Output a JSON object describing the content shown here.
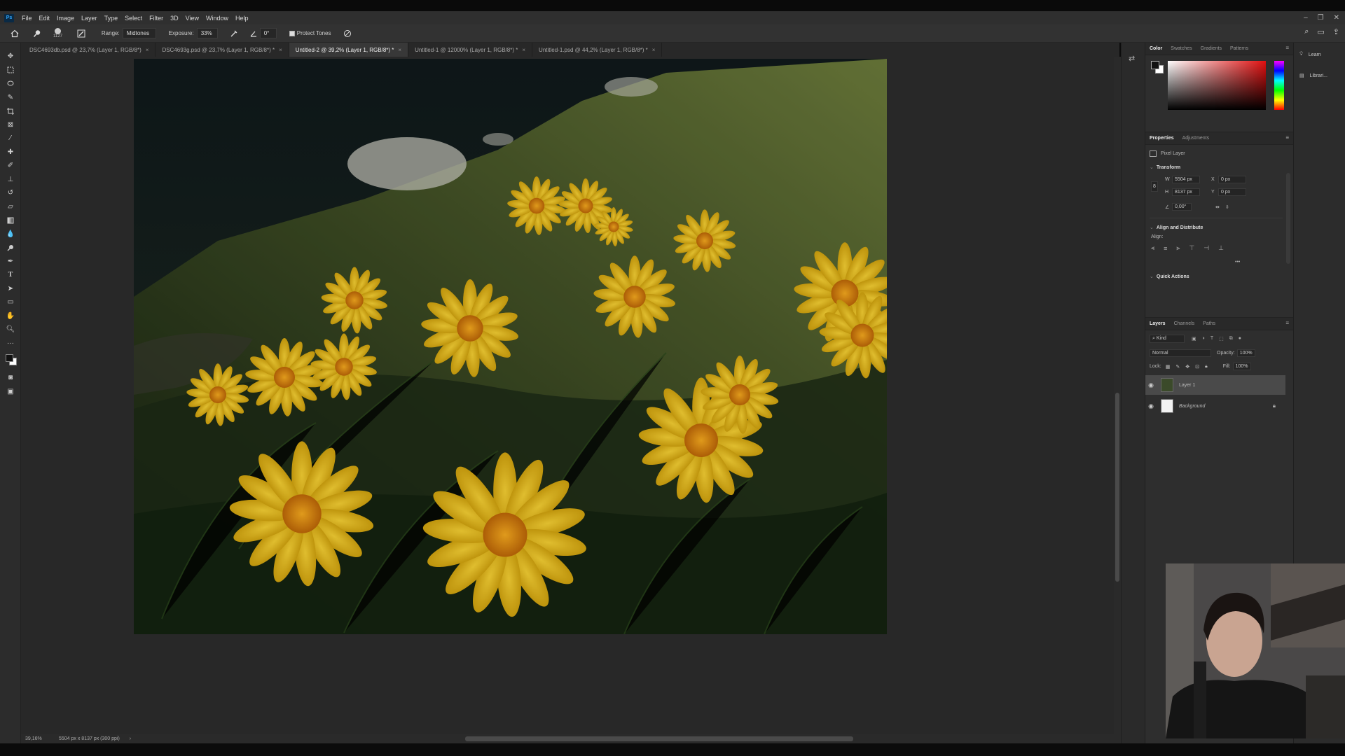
{
  "app": {
    "logo": "Ps"
  },
  "menu": [
    "File",
    "Edit",
    "Image",
    "Layer",
    "Type",
    "Select",
    "Filter",
    "3D",
    "View",
    "Window",
    "Help"
  ],
  "window_controls": {
    "minimize": "–",
    "restore": "❐",
    "close": "✕"
  },
  "options_bar": {
    "brush_size": "1127",
    "range_label": "Range:",
    "range_value": "Midtones",
    "exposure_label": "Exposure:",
    "exposure_value": "33%",
    "angle_value": "0°",
    "protect_tones": "Protect Tones"
  },
  "tabs": [
    {
      "label": "DSC4693db.psd @ 23,7% (Layer 1, RGB/8*)",
      "close": "×"
    },
    {
      "label": "DSC4693g.psd @ 23,7% (Layer 1, RGB/8*) *",
      "close": "×"
    },
    {
      "label": "Untitled-2 @ 39,2% (Layer 1, RGB/8*) *",
      "close": "×"
    },
    {
      "label": "Untitled-1 @ 12000% (Layer 1, RGB/8*) *",
      "close": "×"
    },
    {
      "label": "Untitled-1.psd @ 44,2% (Layer 1, RGB/8*) *",
      "close": "×"
    }
  ],
  "status": {
    "zoom": "39,16%",
    "doc_size": "5504 px x 8137 px (300 ppi)",
    "arrow": "›"
  },
  "color_panel": {
    "tabs": [
      "Color",
      "Swatches",
      "Gradients",
      "Patterns"
    ]
  },
  "properties_panel": {
    "tabs": [
      "Properties",
      "Adjustments"
    ],
    "layer_type": "Pixel Layer",
    "transform_title": "Transform",
    "w_label": "W",
    "w_value": "5504 px",
    "h_label": "H",
    "h_value": "8137 px",
    "x_label": "X",
    "x_value": "0 px",
    "y_label": "Y",
    "y_value": "0 px",
    "angle_value": "0,00°",
    "align_title": "Align and Distribute",
    "align_label": "Align:",
    "more": "•••",
    "quick_actions_title": "Quick Actions"
  },
  "layers_panel": {
    "tabs": [
      "Layers",
      "Channels",
      "Paths"
    ],
    "filter_kind": "Kind",
    "blend_mode": "Normal",
    "opacity_label": "Opacity:",
    "opacity_value": "100%",
    "lock_label": "Lock:",
    "fill_label": "Fill:",
    "fill_value": "100%",
    "layers": [
      {
        "name": "Layer 1",
        "visible": true,
        "selected": true
      },
      {
        "name": "Background",
        "visible": true,
        "selected": false,
        "locked": true
      }
    ]
  },
  "right_strip": {
    "learn": "Learn",
    "libraries": "Librari..."
  }
}
